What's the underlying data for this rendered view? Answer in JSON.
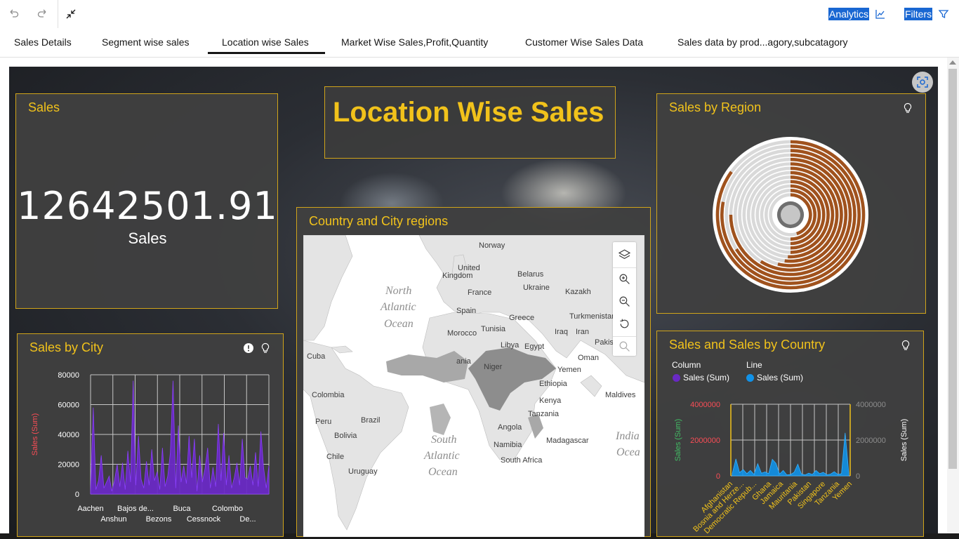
{
  "toolbar": {
    "undo_icon": "undo-icon",
    "redo_icon": "redo-icon",
    "collapse_icon": "collapse-icon",
    "analytics_label": "Analytics",
    "filters_label": "Filters"
  },
  "tabs": [
    {
      "label": "Sales Details"
    },
    {
      "label": "Segment wise sales"
    },
    {
      "label": "Location wise Sales",
      "active": true
    },
    {
      "label": "Market Wise Sales,Profit,Quantity"
    },
    {
      "label": "Customer Wise Sales Data"
    },
    {
      "label": "Sales data by prod...agory,subcatagory"
    }
  ],
  "dashboard": {
    "heading": "Location Wise Sales",
    "sales_kpi": {
      "title": "Sales",
      "value": "12642501.91",
      "label": "Sales"
    },
    "region": {
      "title": "Sales by Region",
      "colors": {
        "filled": "#a0521d",
        "empty": "#d9d9d9"
      }
    },
    "map": {
      "title": "Country and City regions",
      "labels": {
        "oceans": [
          "North",
          "Atlantic",
          "Ocean",
          "South",
          "Atlantic",
          "Ocean",
          "India",
          "Ocea"
        ],
        "countries": [
          "Norway",
          "United",
          "Kingdom",
          "Belarus",
          "Ukraine",
          "France",
          "Kazakh",
          "Spain",
          "Greece",
          "Turkmenistan",
          "Morocco",
          "Tunisia",
          "Iraq",
          "Iran",
          "Pakis",
          "Libya",
          "Egypt",
          "Oman",
          "Cuba",
          "Niger",
          "ania",
          "Yemen",
          "Ethiopia",
          "Maldives",
          "Colombia",
          "Kenya",
          "Tanzania",
          "Peru",
          "Brazil",
          "Angola",
          "Bolivia",
          "Namibia",
          "Madagascar",
          "Chile",
          "South Africa",
          "Uruguay"
        ]
      }
    },
    "city": {
      "title": "Sales by City",
      "ylabel": "Sales (Sum)",
      "yticks": [
        "80000",
        "60000",
        "40000",
        "20000",
        "0"
      ],
      "xlabels_row1": [
        "Aachen",
        "Bajos de...",
        "Buca",
        "Colombo"
      ],
      "xlabels_row2": [
        "Anshun",
        "Bezons",
        "Cessnock",
        "De..."
      ]
    },
    "country": {
      "title": "Sales and Sales by Country",
      "legend_column_header": "Column",
      "legend_column_item": "Sales (Sum)",
      "legend_line_header": "Line",
      "legend_line_item": "Sales (Sum)",
      "ylabel_left": "Sales (Sum)",
      "ylabel_right": "Sales (Sum)",
      "yticks_left": [
        "4000000",
        "2000000",
        "0"
      ],
      "yticks_right": [
        "4000000",
        "2000000",
        "0"
      ],
      "xlabels": [
        "Afghanistan",
        "Bosnia and Herze...",
        "Democratic Repub...",
        "Ghana",
        "Jamaica",
        "Mauritania",
        "Pakistan",
        "Singapore",
        "Tanzania",
        "Yemen"
      ]
    }
  },
  "chart_data": [
    {
      "type": "area",
      "title": "Sales by City",
      "xlabel": "",
      "ylabel": "Sales (Sum)",
      "ylim": [
        0,
        80000
      ],
      "grid": true,
      "categories": [
        "Aachen",
        "Anshun",
        "Bajos de...",
        "Bezons",
        "Buca",
        "Cessnock",
        "Colombo",
        "De..."
      ],
      "series": [
        {
          "name": "Sales (Sum)",
          "color": "#6929c4",
          "values": [
            2000,
            58000,
            3000,
            9000,
            26000,
            4000,
            8000,
            12000,
            2000,
            9000,
            20000,
            5000,
            21000,
            3000,
            29000,
            8000,
            76000,
            6000,
            39000,
            10000,
            4000,
            22000,
            6000,
            30000,
            9000,
            15000,
            3000,
            31000,
            5000,
            12000,
            28000,
            76000,
            4000,
            46000,
            8000,
            19000,
            7000,
            39000,
            11000,
            37000,
            2000,
            26000,
            8000,
            17000,
            31000,
            4000,
            18000,
            5000,
            47000,
            9000,
            41000,
            6000,
            26000,
            4000,
            11000,
            21000,
            6000,
            37000,
            11000,
            10000,
            19000,
            6000,
            28000,
            5000,
            42000,
            18000,
            4000,
            19000
          ]
        }
      ]
    },
    {
      "type": "bar",
      "title": "Sales and Sales by Country",
      "ylim": [
        0,
        4000000
      ],
      "grid": true,
      "categories": [
        "Afghanistan",
        "Bosnia and Herze...",
        "Democratic Repub...",
        "Ghana",
        "Jamaica",
        "Mauritania",
        "Pakistan",
        "Singapore",
        "Tanzania",
        "Yemen"
      ],
      "series": [
        {
          "name": "Sales (Sum)",
          "color": "#1192e8",
          "values": [
            120000,
            950000,
            180000,
            350000,
            120000,
            300000,
            80000,
            680000,
            150000,
            220000,
            120000,
            920000,
            700000,
            100000,
            300000,
            50000,
            70000,
            200000,
            650000,
            100000,
            50000,
            150000,
            80000,
            300000,
            120000,
            200000,
            60000,
            100000,
            230000,
            80000,
            120000,
            2400000,
            150000
          ]
        }
      ]
    },
    {
      "type": "pie",
      "title": "Sales by Region",
      "rings": [
        0.85,
        0.78,
        0.66,
        0.75,
        0.59,
        0.54,
        0.52,
        0.51,
        0.5,
        0.5,
        0.5,
        0.5,
        0.45
      ]
    }
  ]
}
